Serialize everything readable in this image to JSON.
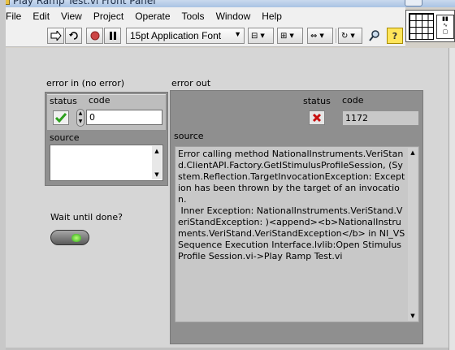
{
  "window": {
    "title": "Play Ramp Test.vi Front Panel"
  },
  "menu": [
    "File",
    "Edit",
    "View",
    "Project",
    "Operate",
    "Tools",
    "Window",
    "Help"
  ],
  "toolbar": {
    "font": "15pt Application Font"
  },
  "error_in": {
    "label": "error in (no error)",
    "status_label": "status",
    "code_label": "code",
    "code_value": "0",
    "source_label": "source",
    "source_value": ""
  },
  "error_out": {
    "label": "error out",
    "status_label": "status",
    "code_label": "code",
    "code_value": "1172",
    "source_label": "source",
    "source_value": "Error calling method NationalInstruments.VeriStand.ClientAPI.Factory.GetIStimulusProfileSession, (System.Reflection.TargetInvocationException: Exception has been thrown by the target of an invocation.\n Inner Exception: NationalInstruments.VeriStand.VeriStandException: )<append><b>NationalInstruments.VeriStand.VeriStandException</b> in NI_VS Sequence Execution Interface.lvlib:Open Stimulus Profile Session.vi->Play Ramp Test.vi"
  },
  "wait_until_done": {
    "label": "Wait until done?",
    "value": true
  },
  "colors": {
    "status_ok": "#2ea01f",
    "status_error": "#c81010",
    "led_on": "#5ee02a"
  }
}
